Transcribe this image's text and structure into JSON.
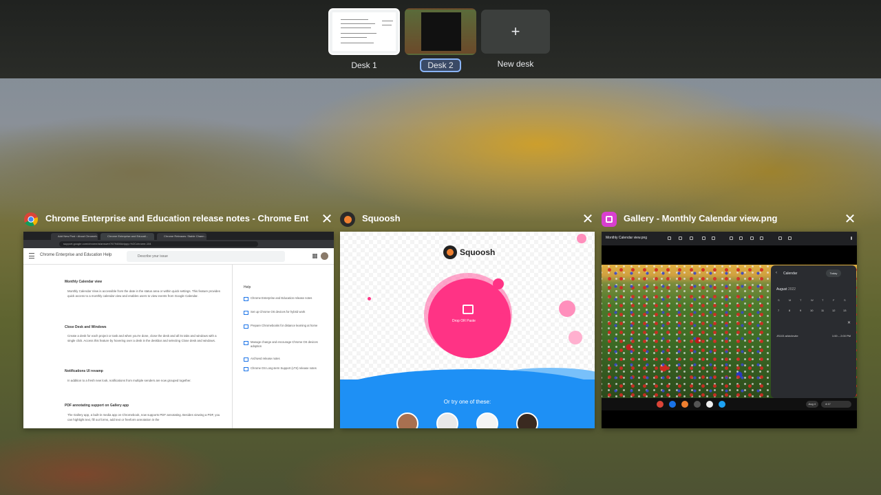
{
  "desks": [
    {
      "label": "Desk 1"
    },
    {
      "label": "Desk 2"
    },
    {
      "label": "New desk",
      "icon": "plus-icon",
      "glyph": "+"
    }
  ],
  "windows": [
    {
      "title": "Chrome Enterprise and Education release notes - Chrome Enterpri...",
      "icon": "chrome-icon",
      "tabs": [
        "Add New Post ‹ About Chromeb...",
        "Chrome Enterprise and Educati...",
        "Chrome Releases: Stable Chann..."
      ],
      "url": "support.google.com/chrome/a/answer/7679408#zippy=%2Cchrome-104",
      "help_title": "Chrome Enterprise and Education Help",
      "search_placeholder": "Describe your issue",
      "sections": [
        {
          "heading": "Monthly Calendar view",
          "body": "Monthly Calendar View is accessible from the date in the status area or within quick settings. This feature provides quick access to a monthly calendar view and enables users to view events from Google Calendar."
        },
        {
          "heading": "Close Desk and Windows",
          "body": "Create a desk for each project or task and when you're done, close the desk and all its tabs and windows with a single click. Access this feature by hovering over a desk in the deskbar and selecting Close desk and windows."
        },
        {
          "heading": "Notifications UI revamp",
          "body": "In addition to a fresh new look, notifications from multiple senders are now grouped together."
        },
        {
          "heading": "PDF annotating support on Gallery app",
          "body": "The Gallery app, a built-in media app on Chromebook, now supports PDF annotating. Besides viewing a PDF, you can highlight text, fill out forms, add text or freeform annotation in the"
        }
      ],
      "side_heading": "Help",
      "side_links": [
        "Chrome Enterprise and Education release notes",
        "Set up Chrome OS devices for hybrid work",
        "Prepare Chromebooks for distance learning at home",
        "Manage change and encourage Chrome OS devices adoption",
        "Archived release notes",
        "Chrome OS Long-term Support (LTS) release notes"
      ]
    },
    {
      "title": "Squoosh",
      "icon": "squoosh-icon",
      "logo_text": "Squoosh",
      "drop_text": "Drop OR Paste",
      "try_text": "Or try one of these:"
    },
    {
      "title": "Gallery - Monthly Calendar view.png",
      "icon": "gallery-icon",
      "file_name": "Monthly Calendar view.png",
      "calendar": {
        "header": "Calendar",
        "today_label": "Today",
        "month": "August",
        "year": "2022",
        "weekdays": [
          "S",
          "M",
          "T",
          "W",
          "T",
          "F",
          "S"
        ],
        "days": [
          "7",
          "8",
          "9",
          "10",
          "11",
          "12",
          "13"
        ],
        "event_name": "JS103 at/dv/invite",
        "event_time": "1:00 – 2:00 PM"
      },
      "status": {
        "date": "Aug 4",
        "time": "4:17"
      }
    }
  ],
  "close_glyph": "✕",
  "colors": {
    "desk_active_border": "#8ab4f8",
    "squoosh_pink": "#ff3385",
    "squoosh_blue": "#1e90f5",
    "gallery_icon": "#d93fd0"
  }
}
